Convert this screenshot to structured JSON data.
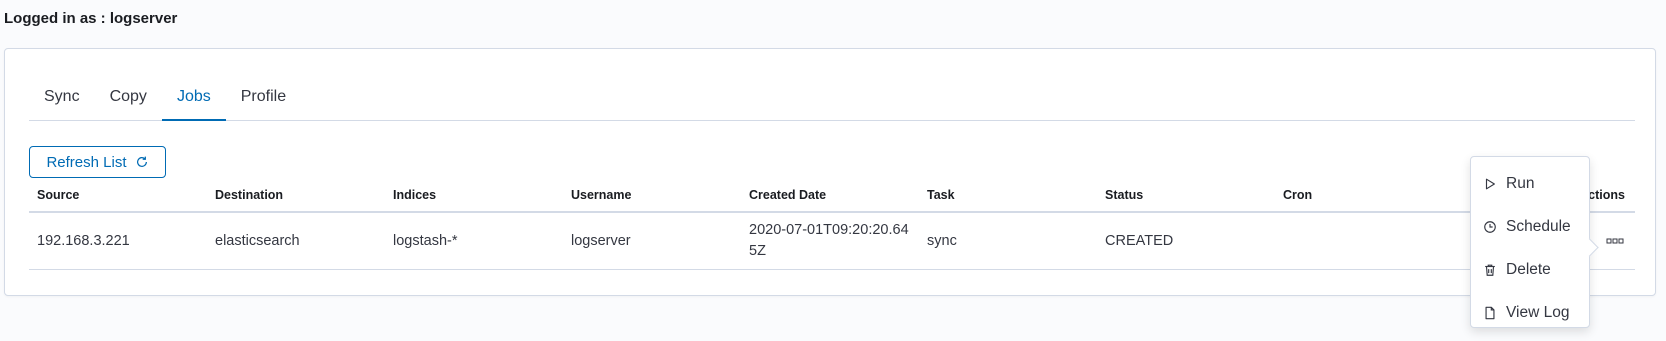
{
  "header": {
    "logged_in": "Logged in as : logserver"
  },
  "tabs": [
    {
      "label": "Sync"
    },
    {
      "label": "Copy"
    },
    {
      "label": "Jobs"
    },
    {
      "label": "Profile"
    }
  ],
  "selected_tab": "Jobs",
  "refresh_button": {
    "label": "Refresh List",
    "icon": "refresh-icon"
  },
  "table": {
    "columns": [
      "Source",
      "Destination",
      "Indices",
      "Username",
      "Created Date",
      "Task",
      "Status",
      "Cron",
      "Actions"
    ],
    "rows": [
      {
        "source": "192.168.3.221",
        "destination": "elasticsearch",
        "indices": "logstash-*",
        "username": "logserver",
        "created_date": "2020-07-01T09:20:20.645Z",
        "task": "sync",
        "status": "CREATED",
        "cron": ""
      }
    ]
  },
  "actions_menu": {
    "items": [
      {
        "label": "Run",
        "icon": "play-icon"
      },
      {
        "label": "Schedule",
        "icon": "clock-icon"
      },
      {
        "label": "Delete",
        "icon": "trash-icon"
      },
      {
        "label": "View Log",
        "icon": "document-icon"
      }
    ]
  },
  "colors": {
    "accent": "#006bb4",
    "border": "#d3dae6",
    "text": "#343741"
  }
}
